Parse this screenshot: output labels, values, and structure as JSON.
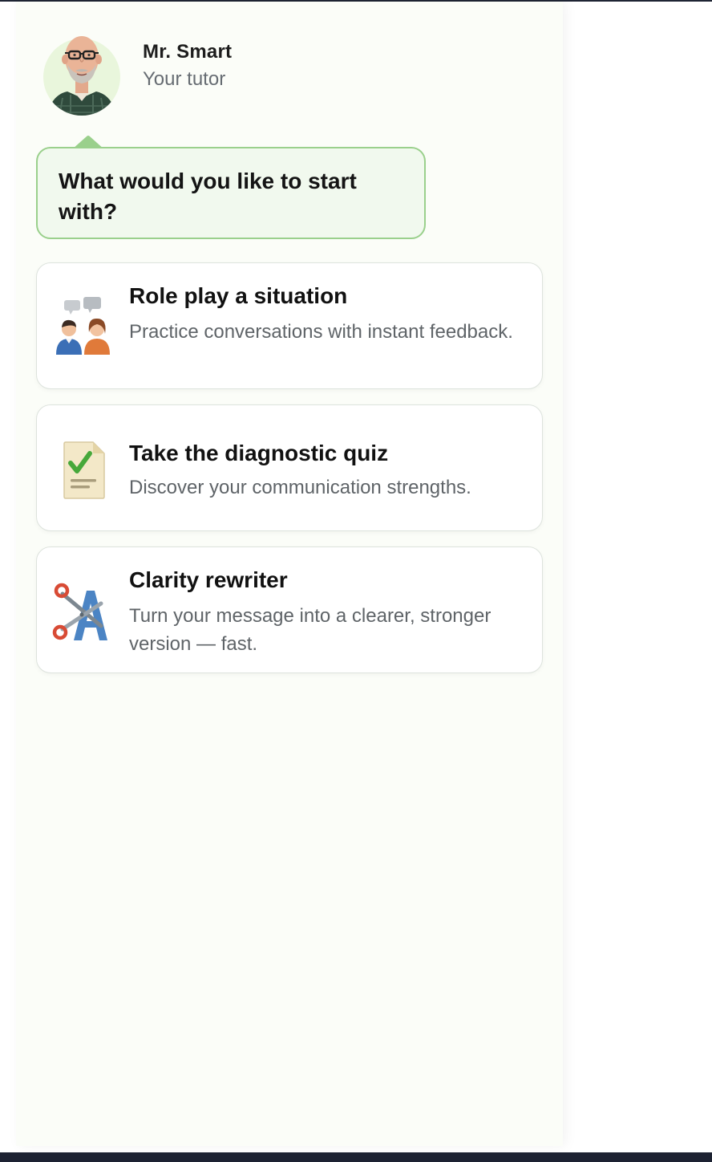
{
  "tutor": {
    "name": "Mr. Smart",
    "role": "Your tutor"
  },
  "prompt": {
    "text": "What would you like to start with?"
  },
  "options": [
    {
      "title": "Role play a situation",
      "description": "Practice conversations with instant feedback.",
      "icon": "people-talking-icon"
    },
    {
      "title": "Take the diagnostic quiz",
      "description": "Discover your communication strengths.",
      "icon": "checklist-document-icon"
    },
    {
      "title": "Clarity rewriter",
      "description": "Turn your message into a clearer, stronger version — fast.",
      "icon": "scissors-text-icon"
    }
  ],
  "colors": {
    "panel_background": "#fbfdf8",
    "bubble_background": "#f1f9ee",
    "bubble_border": "#9ad08c",
    "card_border": "#dde3dd",
    "page_frame": "#1d2232"
  }
}
